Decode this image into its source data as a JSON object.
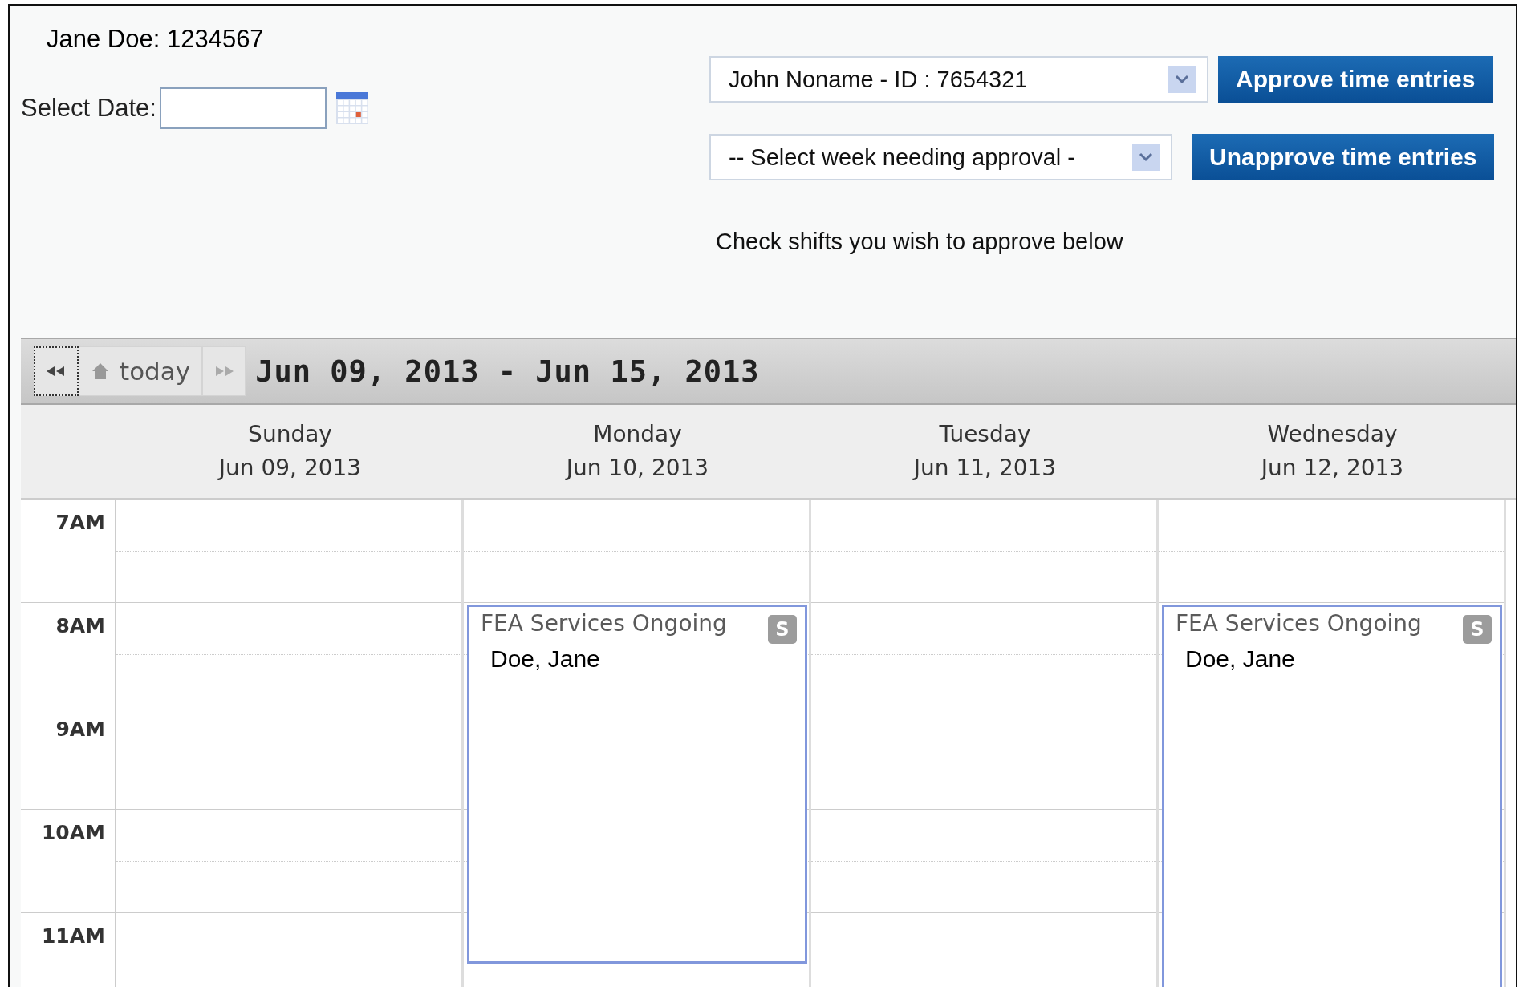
{
  "user_label": "Jane Doe: 1234567",
  "date_field": {
    "label": "Select Date:"
  },
  "employee_select": {
    "value": "John Noname - ID : 7654321"
  },
  "week_select": {
    "value": "-- Select week needing approval -"
  },
  "buttons": [
    "Approve time entries",
    "Unapprove time entries"
  ],
  "instruction": "Check shifts you wish to approve below",
  "calendar": {
    "today": "today",
    "range": "Jun 09, 2013 - Jun 15, 2013",
    "hours": [
      "7AM",
      "8AM",
      "9AM",
      "10AM",
      "11AM"
    ],
    "days": [
      {
        "name": "Sunday",
        "date": "Jun 09, 2013"
      },
      {
        "name": "Monday",
        "date": "Jun 10, 2013",
        "events": [
          {
            "title": "FEA Services Ongoing",
            "badge": "S",
            "person": "Doe, Jane"
          }
        ]
      },
      {
        "name": "Tuesday",
        "date": "Jun 11, 2013"
      },
      {
        "name": "Wednesday",
        "date": "Jun 12, 2013",
        "events": [
          {
            "title": "FEA Services Ongoing",
            "badge": "S",
            "person": "Doe, Jane"
          }
        ]
      }
    ]
  }
}
